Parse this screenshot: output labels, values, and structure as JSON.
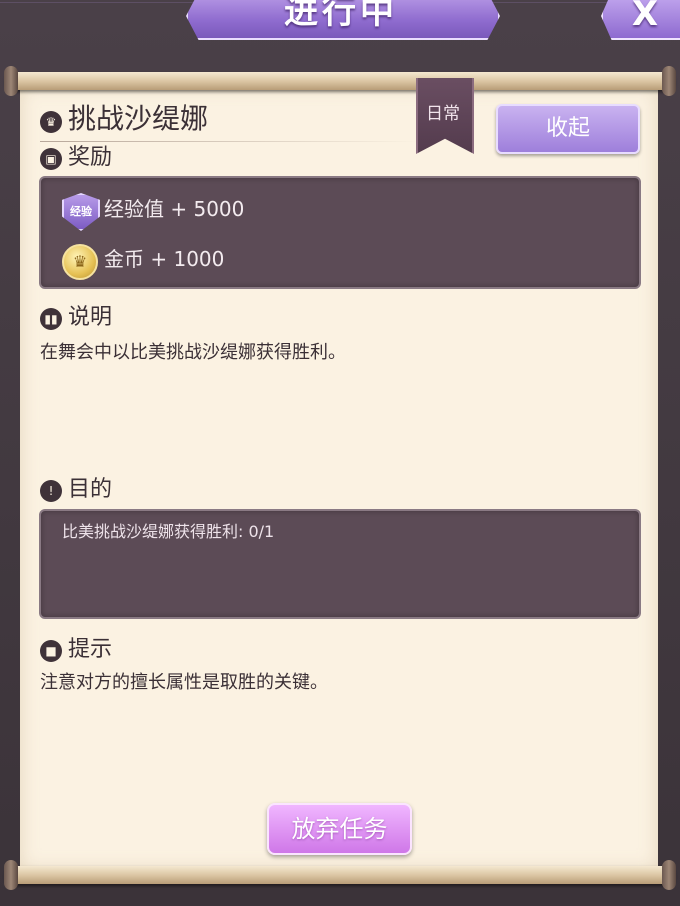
{
  "header": {
    "status_title": "进行中",
    "close_label": "X"
  },
  "quest": {
    "title": "挑战沙缇娜",
    "tag": "日常",
    "collapse_label": "收起",
    "rewards_heading": "奖励",
    "rewards": [
      {
        "icon": "exp-badge-icon",
        "badge_text": "经验",
        "text": "经验值 + 5000"
      },
      {
        "icon": "gold-coin-icon",
        "text": "金币 + 1000"
      }
    ],
    "description_heading": "说明",
    "description": "在舞会中以比美挑战沙缇娜获得胜利。",
    "objective_heading": "目的",
    "objective": "比美挑战沙缇娜获得胜利: 0/1",
    "objective_progress": {
      "current": 0,
      "total": 1
    },
    "hint_heading": "提示",
    "hint": "注意对方的擅长属性是取胜的关键。",
    "abandon_label": "放弃任务"
  },
  "colors": {
    "accent_purple": "#9e7fdb",
    "abandon_pink": "#cf77e8",
    "parchment": "#fbf2e2",
    "panel_dark": "#5c4b56"
  }
}
